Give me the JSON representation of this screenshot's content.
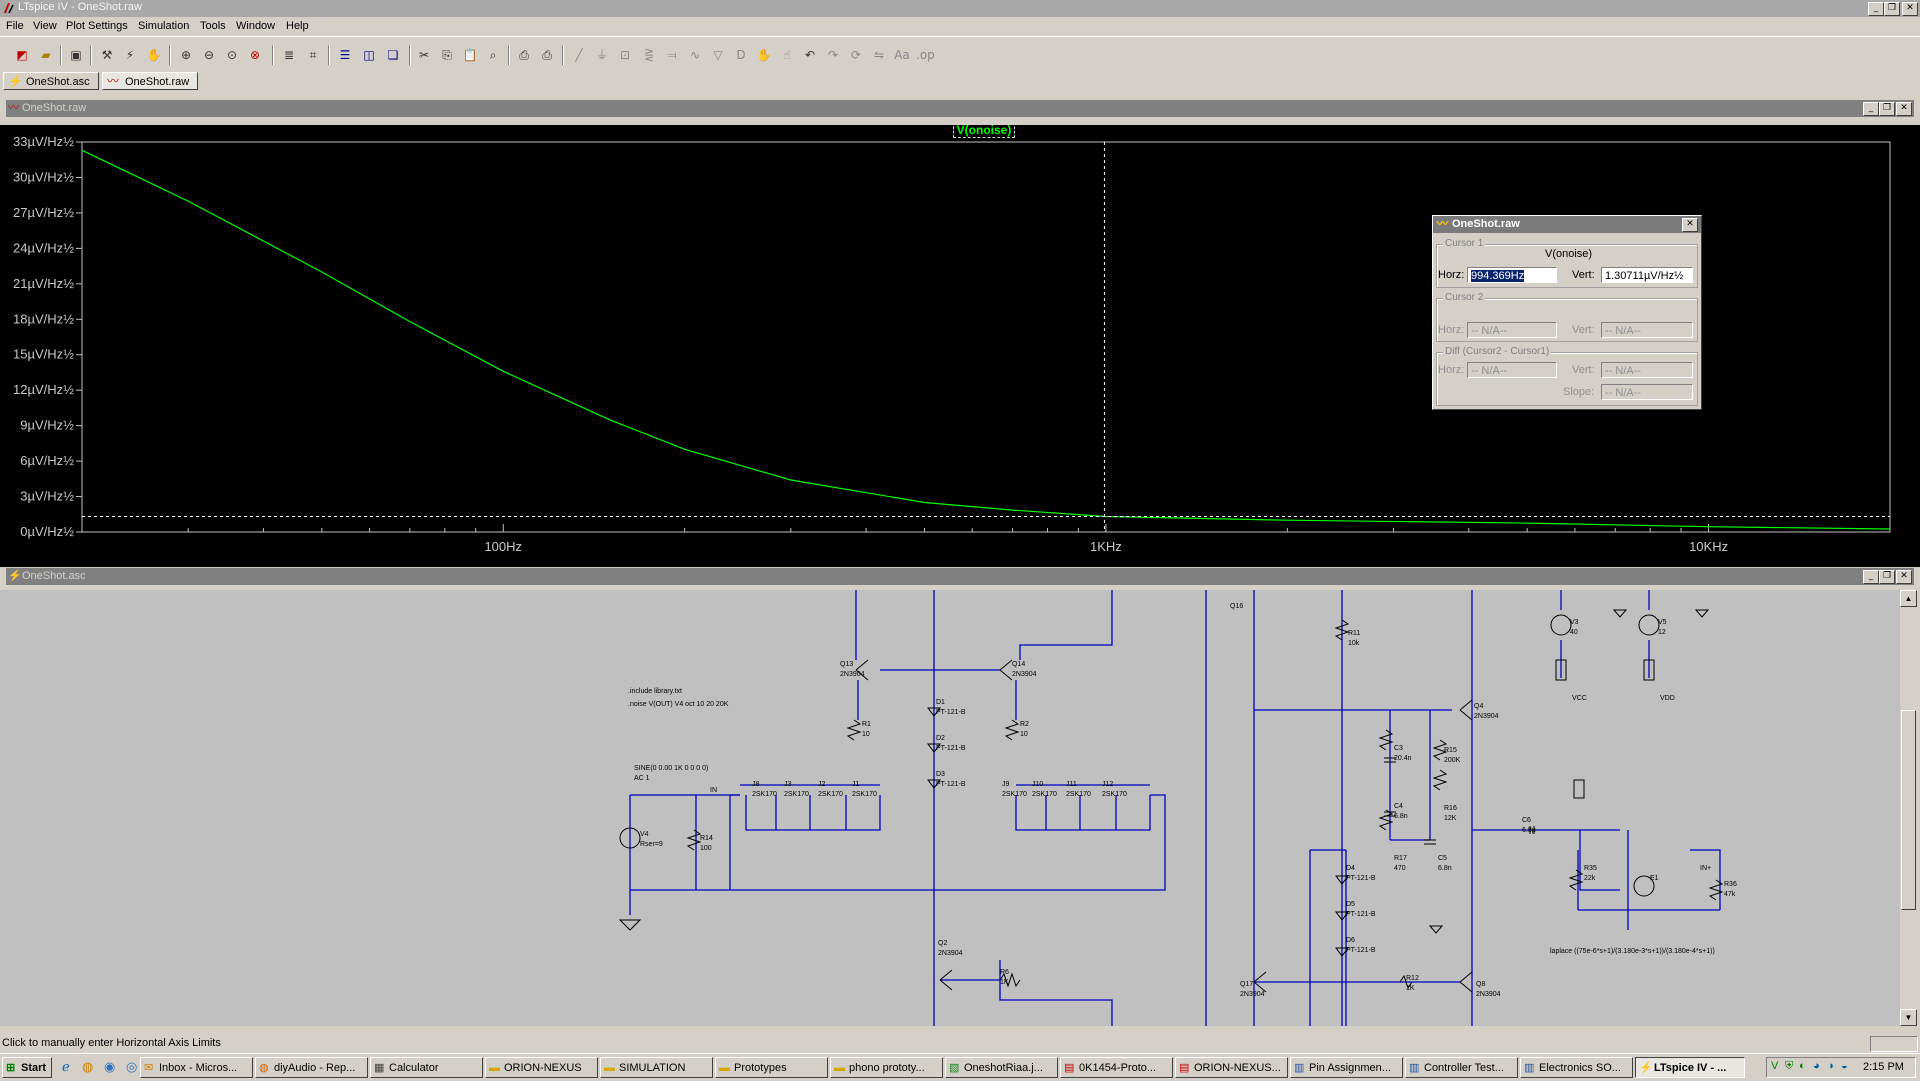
{
  "window": {
    "title": "LTspice IV - OneShot.raw"
  },
  "menu": [
    "File",
    "View",
    "Plot Settings",
    "Simulation",
    "Tools",
    "Window",
    "Help"
  ],
  "toolbar_icons": [
    "new-schematic-icon",
    "open-icon",
    "save-icon",
    "control-panel-icon",
    "run-icon",
    "halt-icon",
    "zoom-in-icon",
    "zoom-out-icon",
    "zoom-fit-icon",
    "zoom-cancel-icon",
    "autorange-icon",
    "cursor-icon",
    "tile-horizontal-icon",
    "tile-vertical-icon",
    "cascade-icon",
    "cut-icon",
    "copy-icon",
    "paste-icon",
    "find-icon",
    "print-preview-icon",
    "print-icon",
    "wire-icon",
    "ground-icon",
    "label-icon",
    "resistor-icon",
    "capacitor-icon",
    "inductor-icon",
    "diode-icon",
    "component-icon",
    "move-icon",
    "drag-icon",
    "undo-icon",
    "redo-icon",
    "rotate-icon",
    "mirror-icon",
    "text-icon",
    "spice-directive-icon"
  ],
  "doc_tabs": [
    {
      "label": "OneShot.asc",
      "icon": "schematic-icon"
    },
    {
      "label": "OneShot.raw",
      "icon": "waveform-icon"
    }
  ],
  "plot": {
    "title": "OneShot.raw",
    "trace_label": "V(onoise)",
    "cursor_x_label": "1KHz"
  },
  "chart_data": {
    "type": "line",
    "title": "",
    "xscale": "log",
    "xlim": [
      20,
      20000
    ],
    "ylim": [
      0,
      33
    ],
    "x_ticks": [
      "100Hz",
      "1KHz",
      "10KHz"
    ],
    "y_ticks": [
      "33µV/Hz½",
      "30µV/Hz½",
      "27µV/Hz½",
      "24µV/Hz½",
      "21µV/Hz½",
      "18µV/Hz½",
      "15µV/Hz½",
      "12µV/Hz½",
      "9µV/Hz½",
      "6µV/Hz½",
      "3µV/Hz½",
      "0µV/Hz½"
    ],
    "series": [
      {
        "name": "V(onoise)",
        "color": "#00ff00",
        "x": [
          20,
          30,
          50,
          70,
          100,
          150,
          200,
          300,
          500,
          700,
          1000,
          2000,
          5000,
          10000,
          20000
        ],
        "y": [
          32.3,
          28.0,
          22.0,
          17.8,
          13.6,
          9.5,
          7.0,
          4.4,
          2.5,
          1.85,
          1.31,
          1.0,
          0.75,
          0.45,
          0.25
        ]
      }
    ],
    "grid": false,
    "cursor": {
      "x": 994.369,
      "y": 1.30711
    }
  },
  "cursor_dialog": {
    "title": "OneShot.raw",
    "cursor1": {
      "group": "Cursor 1",
      "trace": "V(onoise)",
      "horz_label": "Horz:",
      "horz": "994.369Hz",
      "vert_label": "Vert:",
      "vert": "1.30711µV/Hz½"
    },
    "cursor2": {
      "group": "Cursor 2",
      "horz_label": "Horz:",
      "horz": "-- N/A--",
      "vert_label": "Vert:",
      "vert": "-- N/A--"
    },
    "diff": {
      "group": "Diff (Cursor2 - Cursor1)",
      "horz_label": "Horz:",
      "horz": "-- N/A--",
      "vert_label": "Vert:",
      "vert": "-- N/A--",
      "slope_label": "Slope:",
      "slope": "-- N/A--"
    }
  },
  "schematic": {
    "title": "OneShot.asc",
    "directives": [
      ".include library.txt",
      ".noise V(OUT) V4 oct 10 20 20K"
    ],
    "source_text": [
      "SINE(0 0.00 1K 0 0 0 0)",
      "AC 1"
    ],
    "net_labels": [
      "IN",
      "IN+"
    ],
    "laplace": "laplace ((75e-6*s+1)/(3.180e-3*s+1))/(3.180e-4*s+1))",
    "parts": [
      {
        "ref": "Q13",
        "val": "2N3904"
      },
      {
        "ref": "Q14",
        "val": "2N3904"
      },
      {
        "ref": "Q16",
        "val": ""
      },
      {
        "ref": "D1",
        "val": "PT-121-B"
      },
      {
        "ref": "D2",
        "val": "PT-121-B"
      },
      {
        "ref": "D3",
        "val": "PT-121-B"
      },
      {
        "ref": "R1",
        "val": "10"
      },
      {
        "ref": "R2",
        "val": "10"
      },
      {
        "ref": "J8",
        "val": "2SK170"
      },
      {
        "ref": "J3",
        "val": "2SK170"
      },
      {
        "ref": "J2",
        "val": "2SK170"
      },
      {
        "ref": "J1",
        "val": "2SK170"
      },
      {
        "ref": "J9",
        "val": "2SK170"
      },
      {
        "ref": "J10",
        "val": "2SK170"
      },
      {
        "ref": "J11",
        "val": "2SK170"
      },
      {
        "ref": "J12",
        "val": "2SK170"
      },
      {
        "ref": "V4",
        "val": "Rser=9"
      },
      {
        "ref": "R14",
        "val": "100"
      },
      {
        "ref": "Q2",
        "val": "2N3904"
      },
      {
        "ref": "R6",
        "val": "1K"
      },
      {
        "ref": "R11",
        "val": "10k"
      },
      {
        "ref": "Q4",
        "val": "2N3904"
      },
      {
        "ref": "C3",
        "val": "20.4n"
      },
      {
        "ref": "R15",
        "val": "200K"
      },
      {
        "ref": "C4",
        "val": "6.8n"
      },
      {
        "ref": "R16",
        "val": "12K"
      },
      {
        "ref": "R17",
        "val": "470"
      },
      {
        "ref": "C5",
        "val": "6.8n"
      },
      {
        "ref": "D4",
        "val": "PT-121-B"
      },
      {
        "ref": "D5",
        "val": "PT-121-B"
      },
      {
        "ref": "D6",
        "val": "PT-121-B"
      },
      {
        "ref": "R12",
        "val": "1K"
      },
      {
        "ref": "Q17",
        "val": "2N3904"
      },
      {
        "ref": "Q8",
        "val": "2N3904"
      },
      {
        "ref": "V3",
        "val": "40"
      },
      {
        "ref": "V5",
        "val": "12"
      },
      {
        "ref": "VCC",
        "val": ""
      },
      {
        "ref": "VDD",
        "val": ""
      },
      {
        "ref": "C6",
        "val": "6.8µ"
      },
      {
        "ref": "R35",
        "val": "22k"
      },
      {
        "ref": "R36",
        "val": "47k"
      },
      {
        "ref": "E1",
        "val": ""
      }
    ]
  },
  "status": {
    "text": "Click to manually enter Horizontal Axis Limits"
  },
  "taskbar": {
    "start": "Start",
    "items": [
      {
        "label": "Inbox - Micros...",
        "icon": "outlook-icon"
      },
      {
        "label": "diyAudio - Rep...",
        "icon": "browser-icon"
      },
      {
        "label": "Calculator",
        "icon": "calculator-icon"
      },
      {
        "label": "ORION-NEXUS",
        "icon": "folder-icon"
      },
      {
        "label": "SIMULATION",
        "icon": "folder-icon"
      },
      {
        "label": "Prototypes",
        "icon": "folder-icon"
      },
      {
        "label": "phono prototy...",
        "icon": "folder-icon"
      },
      {
        "label": "OneshotRiaa.j...",
        "icon": "image-icon"
      },
      {
        "label": "0K1454-Proto...",
        "icon": "pdf-icon"
      },
      {
        "label": "ORION-NEXUS...",
        "icon": "pdf-icon"
      },
      {
        "label": "Pin Assignmen...",
        "icon": "document-icon"
      },
      {
        "label": "Controller Test...",
        "icon": "document-icon"
      },
      {
        "label": "Electronics SO...",
        "icon": "document-icon"
      },
      {
        "label": "LTspice IV - ...",
        "icon": "ltspice-icon"
      }
    ],
    "clock": "2:15 PM"
  }
}
